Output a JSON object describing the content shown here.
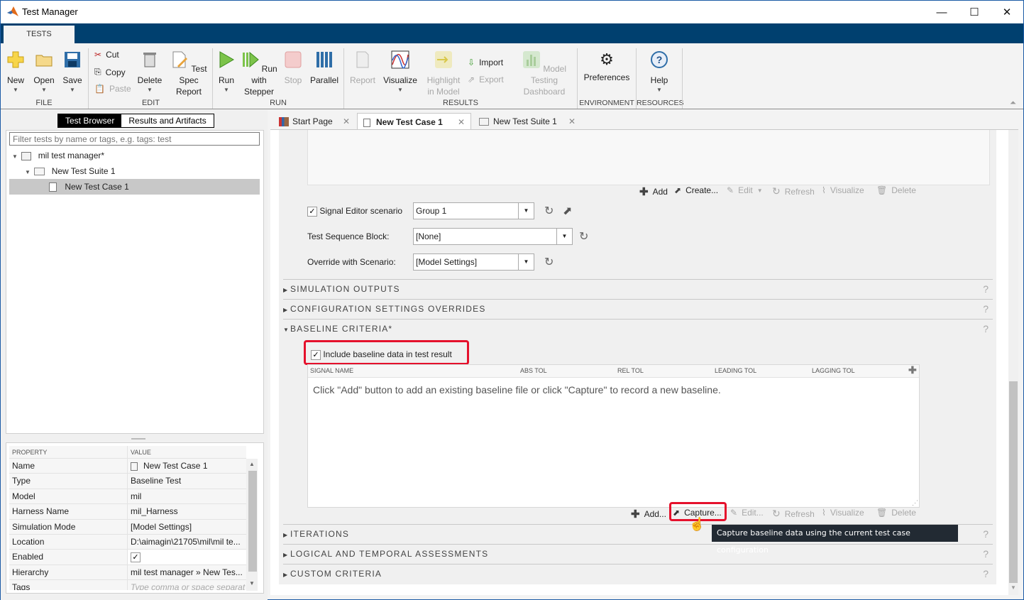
{
  "window": {
    "title": "Test Manager",
    "controls": {
      "minimize": "—",
      "maximize": "☐",
      "close": "✕"
    }
  },
  "ribbon_tabs": [
    {
      "label": "TESTS"
    }
  ],
  "toolstrip": {
    "file": {
      "label": "FILE",
      "new": "New",
      "open": "Open",
      "save": "Save"
    },
    "edit": {
      "label": "EDIT",
      "cut": "Cut",
      "copy": "Copy",
      "paste": "Paste",
      "delete": "Delete",
      "test_spec_report_1": "Test Spec",
      "test_spec_report_2": "Report"
    },
    "run": {
      "label": "RUN",
      "run": "Run",
      "run_with_stepper_1": "Run with",
      "run_with_stepper_2": "Stepper",
      "stop": "Stop",
      "parallel": "Parallel"
    },
    "results": {
      "label": "RESULTS",
      "report": "Report",
      "visualize": "Visualize",
      "highlight_1": "Highlight",
      "highlight_2": "in Model",
      "import": "Import",
      "export": "Export",
      "dashboard_1": "Model Testing",
      "dashboard_2": "Dashboard"
    },
    "environment": {
      "label": "ENVIRONMENT",
      "preferences": "Preferences"
    },
    "resources": {
      "label": "RESOURCES",
      "help": "Help"
    }
  },
  "left_panel": {
    "segments": [
      "Test Browser",
      "Results and Artifacts"
    ],
    "filter_placeholder": "Filter tests by name or tags, e.g. tags: test",
    "tree": [
      {
        "label": "mil test manager*",
        "level": 0,
        "icon": "test-file-icon"
      },
      {
        "label": "New Test Suite 1",
        "level": 1,
        "icon": "folder-icon"
      },
      {
        "label": "New Test Case 1",
        "level": 2,
        "icon": "document-icon",
        "selected": true
      }
    ],
    "properties": {
      "headers": [
        "PROPERTY",
        "VALUE"
      ],
      "rows": [
        {
          "key": "Name",
          "value": "New Test Case 1"
        },
        {
          "key": "Type",
          "value": "Baseline Test"
        },
        {
          "key": "Model",
          "value": "mil"
        },
        {
          "key": "Harness Name",
          "value": "mil_Harness"
        },
        {
          "key": "Simulation Mode",
          "value": "[Model Settings]"
        },
        {
          "key": "Location",
          "value": "D:\\aimagin\\21705\\mil\\mil te..."
        },
        {
          "key": "Enabled",
          "value": "✓"
        },
        {
          "key": "Hierarchy",
          "value": "mil test manager » New Tes..."
        },
        {
          "key": "Tags",
          "value": "Type comma or space separat"
        }
      ]
    }
  },
  "doc_tabs": [
    {
      "label": "Start Page",
      "active": false
    },
    {
      "label": "New Test Case 1",
      "active": true
    },
    {
      "label": "New Test Suite 1",
      "active": false
    }
  ],
  "inputs_toolbar": {
    "add": "Add",
    "create": "Create...",
    "edit": "Edit",
    "refresh": "Refresh",
    "visualize": "Visualize",
    "delete": "Delete"
  },
  "scenario": {
    "signal_editor_label": "Signal Editor scenario",
    "signal_editor_checked": true,
    "signal_editor_value": "Group 1",
    "test_sequence_label": "Test Sequence Block:",
    "test_sequence_value": "[None]",
    "override_label": "Override with Scenario:",
    "override_value": "[Model Settings]"
  },
  "sections": {
    "simulation_outputs": "SIMULATION OUTPUTS",
    "config_overrides": "CONFIGURATION SETTINGS OVERRIDES",
    "baseline_criteria": "BASELINE CRITERIA*",
    "iterations": "ITERATIONS",
    "logical_temporal": "LOGICAL AND TEMPORAL ASSESSMENTS",
    "custom_criteria": "CUSTOM CRITERIA",
    "help": "?"
  },
  "baseline": {
    "include_label": "Include baseline data in test result",
    "include_checked": true,
    "columns": [
      "SIGNAL NAME",
      "ABS TOL",
      "REL TOL",
      "LEADING TOL",
      "LAGGING TOL"
    ],
    "empty_message": "Click \"Add\" button to add an existing baseline file or click \"Capture\" to record a new baseline.",
    "toolbar": {
      "add": "Add...",
      "capture": "Capture...",
      "edit": "Edit...",
      "refresh": "Refresh",
      "visualize": "Visualize",
      "delete": "Delete"
    },
    "tooltip": "Capture baseline data using the current test case configuration"
  },
  "colors": {
    "ribbon": "#00406f",
    "highlight": "#e5112c",
    "tooltip_bg": "#222a33"
  }
}
